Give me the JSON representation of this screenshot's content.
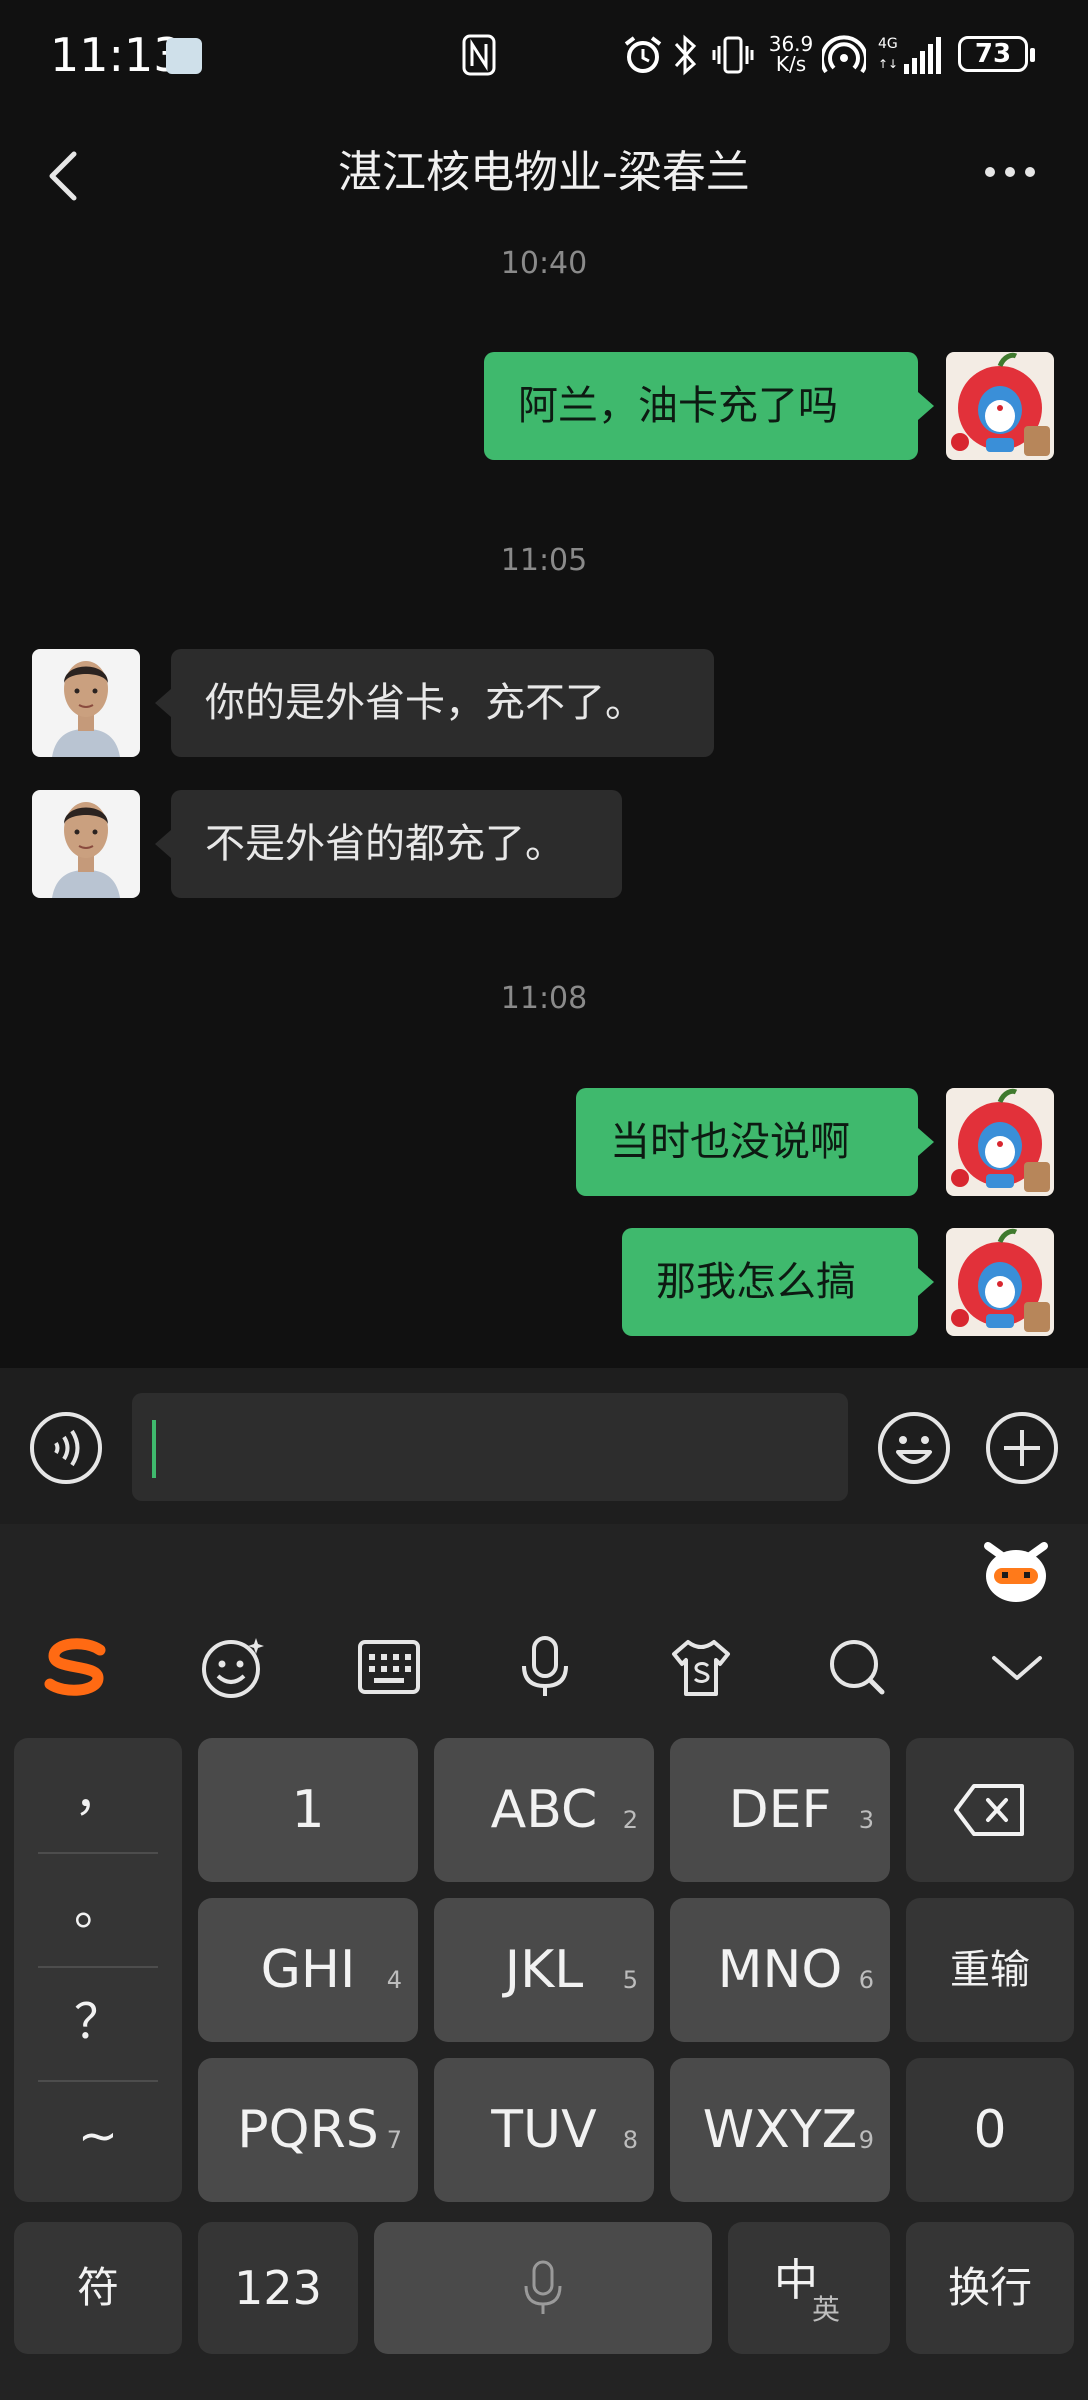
{
  "status_bar": {
    "time": "11:13",
    "speed": "36.9\nK/s",
    "speed_top": "36.9",
    "speed_bottom": "K/s",
    "battery": "73",
    "icons": [
      "nfc-icon",
      "alarm-icon",
      "bluetooth-icon",
      "vibrate-icon",
      "speed",
      "hotspot-icon",
      "signal-4g-icon",
      "battery-icon"
    ]
  },
  "header": {
    "title": "湛江核电物业-梁春兰"
  },
  "messages": [
    {
      "type": "timestamp",
      "text": "10:40"
    },
    {
      "type": "me",
      "text": "阿兰，油卡充了吗"
    },
    {
      "type": "timestamp",
      "text": "11:05"
    },
    {
      "type": "them",
      "text": "你的是外省卡，充不了。"
    },
    {
      "type": "them",
      "text": "不是外省的都充了。"
    },
    {
      "type": "timestamp",
      "text": "11:08"
    },
    {
      "type": "me",
      "text": "当时也没说啊"
    },
    {
      "type": "me",
      "text": "那我怎么搞"
    }
  ],
  "input": {
    "value": ""
  },
  "keyboard": {
    "toolbar": [
      "sogou-logo-icon",
      "emoji-icon",
      "keyboard-icon",
      "microphone-icon",
      "skin-icon",
      "search-icon",
      "collapse-icon"
    ],
    "punct": [
      "，",
      "。",
      "？",
      "~"
    ],
    "keys": {
      "k1": {
        "label": "1",
        "sub": ""
      },
      "k2": {
        "label": "ABC",
        "sub": "2"
      },
      "k3": {
        "label": "DEF",
        "sub": "3"
      },
      "k4": {
        "label": "GHI",
        "sub": "4"
      },
      "k5": {
        "label": "JKL",
        "sub": "5"
      },
      "k6": {
        "label": "MNO",
        "sub": "6"
      },
      "k7": {
        "label": "PQRS",
        "sub": "7"
      },
      "k8": {
        "label": "TUV",
        "sub": "8"
      },
      "k9": {
        "label": "WXYZ",
        "sub": "9"
      },
      "k0": {
        "label": "0",
        "sub": ""
      }
    },
    "reinput": "重输",
    "symbol": "符",
    "numbers": "123",
    "lang_main": "中",
    "lang_sub": "英",
    "enter": "换行"
  },
  "colors": {
    "background": "#111111",
    "bubble_me": "#3fb96d",
    "bubble_them": "#2c2c2c",
    "accent": "#3fb96d",
    "sogou_orange": "#ff6a13"
  }
}
